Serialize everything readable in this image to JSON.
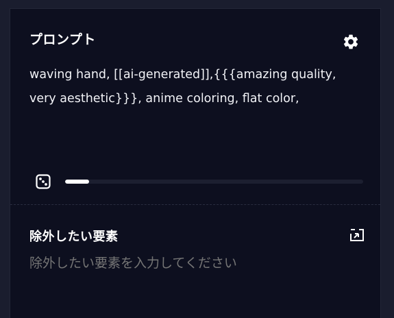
{
  "prompt": {
    "title": "プロンプト",
    "text": "waving hand, [[ai-generated]],{{{amazing quality,\nvery aesthetic}}}, anime coloring, flat color,",
    "token_fill_percent": 8
  },
  "negative": {
    "title": "除外したい要素",
    "placeholder": "除外したい要素を入力してください",
    "value": ""
  },
  "icons": {
    "settings": "gear-icon",
    "random": "dice-icon",
    "clear": "clear-negative-icon"
  },
  "colors": {
    "background": "#1a1d2e",
    "panel": "#0d0f1f",
    "text": "#ffffff",
    "placeholder": "#6f7287"
  }
}
